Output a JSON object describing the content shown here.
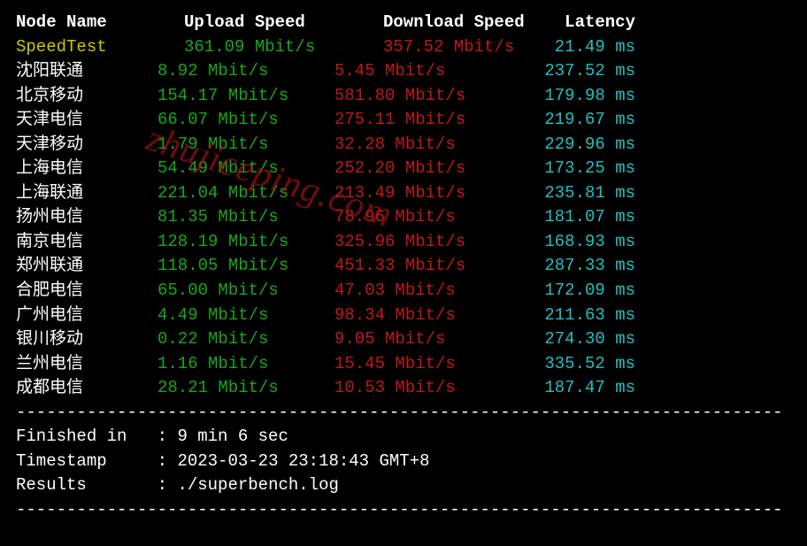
{
  "header": {
    "node": "Node Name",
    "upload": "Upload Speed",
    "download": "Download Speed",
    "latency": "Latency"
  },
  "speedtest_row": {
    "name": "SpeedTest",
    "upload": "361.09 Mbit/s",
    "download": "357.52 Mbit/s",
    "latency": "21.49 ms"
  },
  "rows": [
    {
      "name": "沈阳联通",
      "upload": "8.92 Mbit/s",
      "download": "5.45 Mbit/s",
      "latency": "237.52 ms"
    },
    {
      "name": "北京移动",
      "upload": "154.17 Mbit/s",
      "download": "581.80 Mbit/s",
      "latency": "179.98 ms"
    },
    {
      "name": "天津电信",
      "upload": "66.07 Mbit/s",
      "download": "275.11 Mbit/s",
      "latency": "219.67 ms"
    },
    {
      "name": "天津移动",
      "upload": "1.79 Mbit/s",
      "download": "32.28 Mbit/s",
      "latency": "229.96 ms"
    },
    {
      "name": "上海电信",
      "upload": "54.49 Mbit/s",
      "download": "252.20 Mbit/s",
      "latency": "173.25 ms"
    },
    {
      "name": "上海联通",
      "upload": "221.04 Mbit/s",
      "download": "213.49 Mbit/s",
      "latency": "235.81 ms"
    },
    {
      "name": "扬州电信",
      "upload": "81.35 Mbit/s",
      "download": "78.96 Mbit/s",
      "latency": "181.07 ms"
    },
    {
      "name": "南京电信",
      "upload": "128.19 Mbit/s",
      "download": "325.96 Mbit/s",
      "latency": "168.93 ms"
    },
    {
      "name": "郑州联通",
      "upload": "118.05 Mbit/s",
      "download": "451.33 Mbit/s",
      "latency": "287.33 ms"
    },
    {
      "name": "合肥电信",
      "upload": "65.00 Mbit/s",
      "download": "47.03 Mbit/s",
      "latency": "172.09 ms"
    },
    {
      "name": "广州电信",
      "upload": "4.49 Mbit/s",
      "download": "98.34 Mbit/s",
      "latency": "211.63 ms"
    },
    {
      "name": "银川移动",
      "upload": "0.22 Mbit/s",
      "download": "9.05 Mbit/s",
      "latency": "274.30 ms"
    },
    {
      "name": "兰州电信",
      "upload": "1.16 Mbit/s",
      "download": "15.45 Mbit/s",
      "latency": "335.52 ms"
    },
    {
      "name": "成都电信",
      "upload": "28.21 Mbit/s",
      "download": "10.53 Mbit/s",
      "latency": "187.47 ms"
    }
  ],
  "footer": {
    "finished_label": "Finished in",
    "finished_value": "9 min 6 sec",
    "timestamp_label": "Timestamp",
    "timestamp_value": "2023-03-23 23:18:43 GMT+8",
    "results_label": "Results",
    "results_value": "./superbench.log"
  },
  "divider": "----------------------------------------------------------------------------",
  "watermark": "zhujiceping.com",
  "chart_data": {
    "type": "table",
    "title": "Network Speed Test Results",
    "columns": [
      "Node Name",
      "Upload Speed (Mbit/s)",
      "Download Speed (Mbit/s)",
      "Latency (ms)"
    ],
    "rows": [
      [
        "SpeedTest",
        361.09,
        357.52,
        21.49
      ],
      [
        "沈阳联通",
        8.92,
        5.45,
        237.52
      ],
      [
        "北京移动",
        154.17,
        581.8,
        179.98
      ],
      [
        "天津电信",
        66.07,
        275.11,
        219.67
      ],
      [
        "天津移动",
        1.79,
        32.28,
        229.96
      ],
      [
        "上海电信",
        54.49,
        252.2,
        173.25
      ],
      [
        "上海联通",
        221.04,
        213.49,
        235.81
      ],
      [
        "扬州电信",
        81.35,
        78.96,
        181.07
      ],
      [
        "南京电信",
        128.19,
        325.96,
        168.93
      ],
      [
        "郑州联通",
        118.05,
        451.33,
        287.33
      ],
      [
        "合肥电信",
        65.0,
        47.03,
        172.09
      ],
      [
        "广州电信",
        4.49,
        98.34,
        211.63
      ],
      [
        "银川移动",
        0.22,
        9.05,
        274.3
      ],
      [
        "兰州电信",
        1.16,
        15.45,
        335.52
      ],
      [
        "成都电信",
        28.21,
        10.53,
        187.47
      ]
    ]
  }
}
